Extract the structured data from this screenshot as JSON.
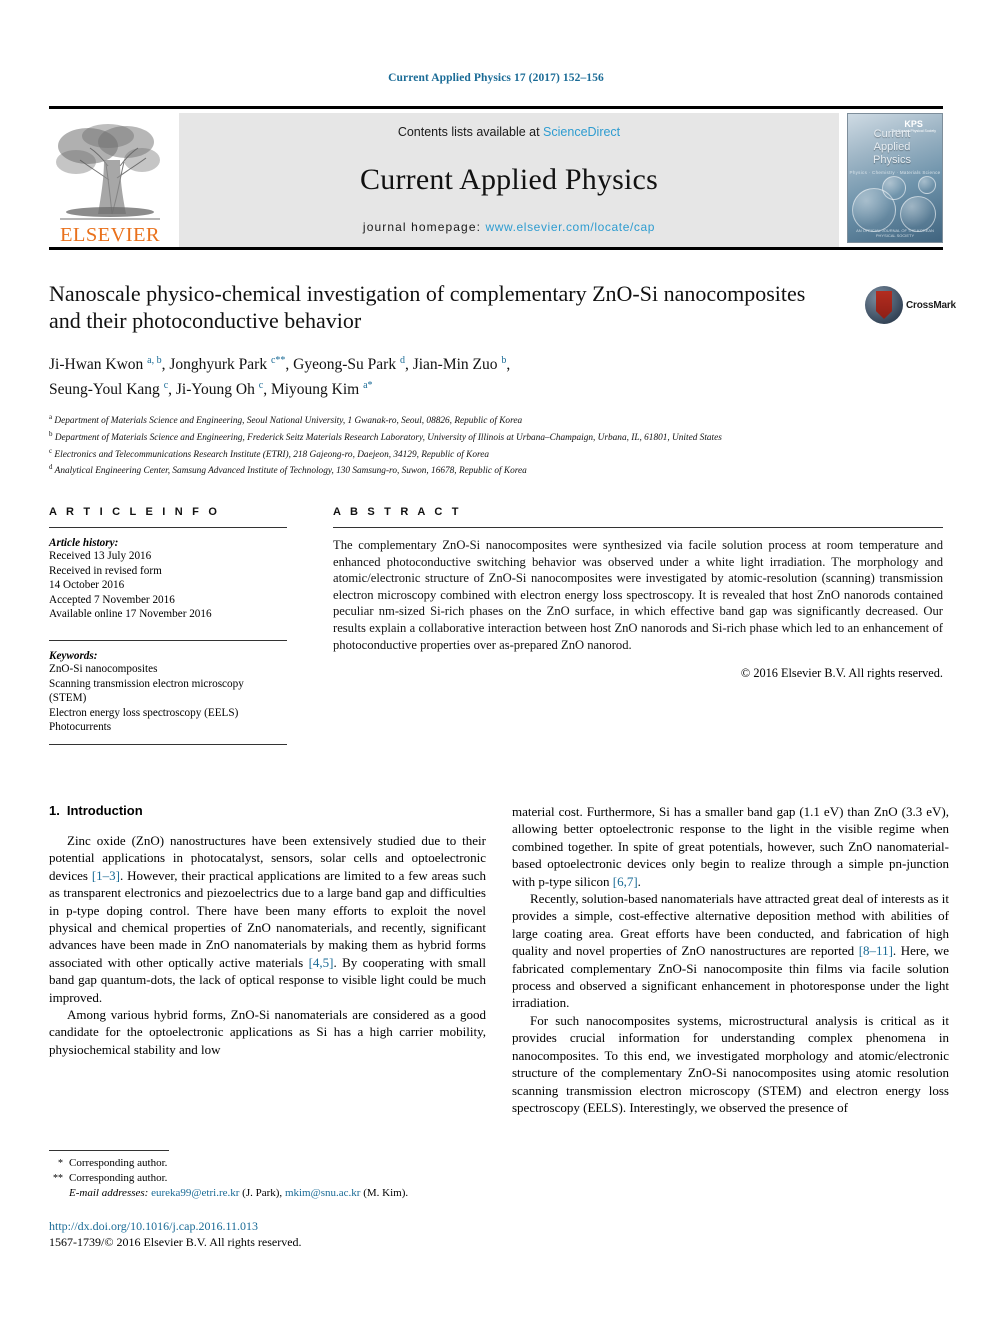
{
  "running_head": "Current Applied Physics 17 (2017) 152–156",
  "masthead": {
    "publisher": "ELSEVIER",
    "contents_prefix": "Contents lists available at ",
    "contents_link": "ScienceDirect",
    "journal_name": "Current Applied Physics",
    "homepage_prefix": "journal homepage: ",
    "homepage_url": "www.elsevier.com/locate/cap",
    "cover": {
      "title_line1": "Current",
      "title_line2": "Applied",
      "title_line3": "Physics",
      "subtitle": "Physics · Chemistry · Materials Science",
      "badge": "KPS",
      "badge_sub": "The Korean Physical Society",
      "publisher_note": "AN OFFICIAL JOURNAL OF THE KOREAN PHYSICAL SOCIETY"
    }
  },
  "article": {
    "title": "Nanoscale physico-chemical investigation of complementary ZnO-Si nanocomposites and their photoconductive behavior",
    "crossmark_label": "CrossMark",
    "authors_line1_a": "Ji-Hwan Kwon ",
    "authors_line1_a_sup": "a, b",
    "authors_line1_b": ", Jonghyurk Park ",
    "authors_line1_b_sup": "c",
    "authors_line1_b_star": "**",
    "authors_line1_c": ", Gyeong-Su Park ",
    "authors_line1_c_sup": "d",
    "authors_line1_d": ", Jian-Min Zuo ",
    "authors_line1_d_sup": "b",
    "authors_line1_end": ",",
    "authors_line2_a": "Seung-Youl Kang ",
    "authors_line2_a_sup": "c",
    "authors_line2_b": ", Ji-Young Oh ",
    "authors_line2_b_sup": "c",
    "authors_line2_c": ", Miyoung Kim ",
    "authors_line2_c_sup": "a",
    "authors_line2_c_star": "*",
    "affiliations": [
      {
        "mark": "a",
        "text": "Department of Materials Science and Engineering, Seoul National University, 1 Gwanak-ro, Seoul, 08826, Republic of Korea"
      },
      {
        "mark": "b",
        "text": "Department of Materials Science and Engineering, Frederick Seitz Materials Research Laboratory, University of Illinois at Urbana–Champaign, Urbana, IL, 61801, United States"
      },
      {
        "mark": "c",
        "text": "Electronics and Telecommunications Research Institute (ETRI), 218 Gajeong-ro, Daejeon, 34129, Republic of Korea"
      },
      {
        "mark": "d",
        "text": "Analytical Engineering Center, Samsung Advanced Institute of Technology, 130 Samsung-ro, Suwon, 16678, Republic of Korea"
      }
    ]
  },
  "article_info": {
    "heading": "A R T I C L E   I N F O",
    "history_label": "Article history:",
    "history": [
      "Received 13 July 2016",
      "Received in revised form",
      "14 October 2016",
      "Accepted 7 November 2016",
      "Available online 17 November 2016"
    ],
    "keywords_label": "Keywords:",
    "keywords": [
      "ZnO-Si nanocomposites",
      "Scanning transmission electron microscopy",
      "(STEM)",
      "Electron energy loss spectroscopy (EELS)",
      "Photocurrents"
    ]
  },
  "abstract": {
    "heading": "A B S T R A C T",
    "text": "The complementary ZnO-Si nanocomposites were synthesized via facile solution process at room temperature and enhanced photoconductive switching behavior was observed under a white light irradiation. The morphology and atomic/electronic structure of ZnO-Si nanocomposites were investigated by atomic-resolution (scanning) transmission electron microscopy combined with electron energy loss spectroscopy. It is revealed that host ZnO nanorods contained peculiar nm-sized Si-rich phases on the ZnO surface, in which effective band gap was significantly decreased. Our results explain a collaborative interaction between host ZnO nanorods and Si-rich phase which led to an enhancement of photoconductive properties over as-prepared ZnO nanorod.",
    "copyright": "© 2016 Elsevier B.V. All rights reserved."
  },
  "body": {
    "section_number": "1.",
    "section_title": "Introduction",
    "left_paragraphs": [
      {
        "parts": [
          {
            "t": "Zinc oxide (ZnO) nanostructures have been extensively studied due to their potential applications in photocatalyst, sensors, solar cells and optoelectronic devices "
          },
          {
            "t": "[1–3]",
            "ref": true
          },
          {
            "t": ". However, their practical applications are limited to a few areas such as transparent electronics and piezoelectrics due to a large band gap and difficulties in p-type doping control. There have been many efforts to exploit the novel physical and chemical properties of ZnO nanomaterials, and recently, significant advances have been made in ZnO nanomaterials by making them as hybrid forms associated with other optically active materials "
          },
          {
            "t": "[4,5]",
            "ref": true
          },
          {
            "t": ". By cooperating with small band gap quantum-dots, the lack of optical response to visible light could be much improved."
          }
        ]
      },
      {
        "parts": [
          {
            "t": "Among various hybrid forms, ZnO-Si nanomaterials are considered as a good candidate for the optoelectronic applications as Si has a high carrier mobility, physiochemical stability and low"
          }
        ]
      }
    ],
    "right_paragraphs": [
      {
        "parts": [
          {
            "t": "material cost. Furthermore, Si has a smaller band gap (1.1 eV) than ZnO (3.3 eV), allowing better optoelectronic response to the light in the visible regime when combined together. In spite of great potentials, however, such ZnO nanomaterial-based optoelectronic devices only begin to realize through a simple pn-junction with p-type silicon "
          },
          {
            "t": "[6,7]",
            "ref": true
          },
          {
            "t": "."
          }
        ],
        "no_indent": true
      },
      {
        "parts": [
          {
            "t": "Recently, solution-based nanomaterials have attracted great deal of interests as it provides a simple, cost-effective alternative deposition method with abilities of large coating area. Great efforts have been conducted, and fabrication of high quality and novel properties of ZnO nanostructures are reported "
          },
          {
            "t": "[8–11]",
            "ref": true
          },
          {
            "t": ". Here, we fabricated complementary ZnO-Si nanocomposite thin films via facile solution process and observed a significant enhancement in photoresponse under the light irradiation."
          }
        ]
      },
      {
        "parts": [
          {
            "t": "For such nanocomposites systems, microstructural analysis is critical as it provides crucial information for understanding complex phenomena in nanocomposites. To this end, we investigated morphology and atomic/electronic structure of the complementary ZnO-Si nanocomposites using atomic resolution scanning transmission electron microscopy (STEM) and electron energy loss spectroscopy (EELS). Interestingly, we observed the presence of"
          }
        ]
      }
    ]
  },
  "footnotes": {
    "corr1_mark": "*",
    "corr1_text": "Corresponding author.",
    "corr2_mark": "**",
    "corr2_text": "Corresponding author.",
    "email_label": "E-mail addresses:",
    "email1": "eureka99@etri.re.kr",
    "email1_owner": " (J. Park), ",
    "email2": "mkim@snu.ac.kr",
    "email2_owner": " (M. Kim)."
  },
  "doi_block": {
    "doi": "http://dx.doi.org/10.1016/j.cap.2016.11.013",
    "issn_line": "1567-1739/© 2016 Elsevier B.V. All rights reserved."
  },
  "colors": {
    "link": "#1a6b96",
    "sciencedirect": "#2e9cd0",
    "elsevier_orange": "#E9711C",
    "band_gray": "#e6e6e6"
  }
}
